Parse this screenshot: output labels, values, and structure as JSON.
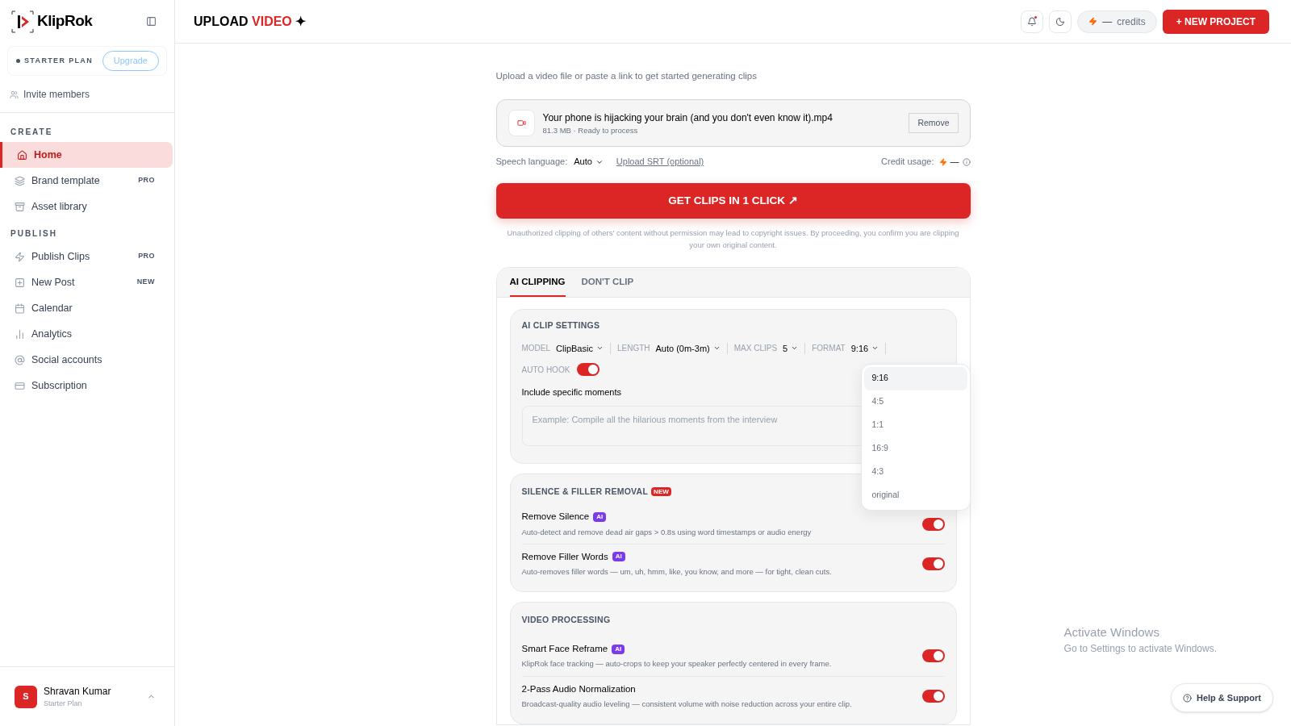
{
  "sidebar": {
    "brand": "KlipRok",
    "plan": {
      "label": "STARTER PLAN",
      "button": "Upgrade"
    },
    "invite": "Invite members",
    "sections": [
      {
        "title": "CREATE",
        "items": [
          {
            "label": "Home",
            "selected": true
          },
          {
            "label": "Brand template",
            "badge": "PRO",
            "selected": false
          },
          {
            "label": "Asset library",
            "selected": false
          }
        ]
      },
      {
        "title": "PUBLISH",
        "items": [
          {
            "label": "Publish Clips",
            "badge": "PRO",
            "selected": false
          },
          {
            "label": "New Post",
            "badge": "NEW",
            "selected": false
          },
          {
            "label": "Calendar",
            "selected": false
          },
          {
            "label": "Analytics",
            "selected": false
          },
          {
            "label": "Social accounts",
            "selected": false
          },
          {
            "label": "Subscription",
            "selected": false
          }
        ]
      }
    ],
    "user": {
      "initial": "S",
      "name": "Shravan Kumar",
      "plan": "Starter Plan"
    }
  },
  "header": {
    "title": "UPLOAD",
    "title_accent": "VIDEO",
    "title_mark": "✦",
    "credits_value": "—",
    "credits_label": "credits",
    "new_project": "+ NEW PROJECT",
    "notification_unread": true
  },
  "upload": {
    "intro": "Upload a video file or paste a link to get started generating clips",
    "file": {
      "name": "Your phone is hijacking your brain (and you don't even know it).mp4",
      "meta": "81.3 MB · Ready to process"
    },
    "remove_button": "Remove",
    "speech_label": "Speech language:",
    "speech_value": "Auto",
    "srt_link": "Upload SRT (optional)",
    "credit_label": "Credit usage:",
    "credit_value": "—",
    "cta": "GET CLIPS IN 1 CLICK ↗",
    "disclaimer": "Unauthorized clipping of others' content without permission may lead to copyright issues. By proceeding, you confirm you are clipping your own original content."
  },
  "tabs": [
    {
      "label": "AI CLIPPING",
      "selected": true
    },
    {
      "label": "DON'T CLIP",
      "selected": false
    }
  ],
  "clip_settings": {
    "title": "AI CLIP SETTINGS",
    "params": [
      {
        "label": "MODEL",
        "value": "ClipBasic"
      },
      {
        "label": "LENGTH",
        "value": "Auto (0m-3m)"
      },
      {
        "label": "MAX CLIPS",
        "value": "5"
      },
      {
        "label": "FORMAT",
        "value": "9:16"
      }
    ],
    "auto_hook": {
      "label": "AUTO HOOK",
      "on": true
    },
    "moments_label": "Include specific moments",
    "moments_placeholder": "Example: Compile all the hilarious moments from the interview"
  },
  "format_menu": {
    "options": [
      {
        "label": "9:16",
        "selected": true
      },
      {
        "label": "4:5",
        "selected": false
      },
      {
        "label": "1:1",
        "selected": false
      },
      {
        "label": "16:9",
        "selected": false
      },
      {
        "label": "4:3",
        "selected": false
      },
      {
        "label": "original",
        "selected": false
      }
    ]
  },
  "groups": [
    {
      "title": "SILENCE & FILLER REMOVAL",
      "badge": "NEW",
      "rows": [
        {
          "title": "Remove Silence",
          "badge": "AI",
          "description": "Auto-detect and remove dead air gaps > 0.8s using word timestamps or audio energy",
          "on": true
        },
        {
          "title": "Remove Filler Words",
          "badge": "AI",
          "description": "Auto-removes filler words — um, uh, hmm, like, you know, and more — for tight, clean cuts.",
          "on": true
        }
      ]
    },
    {
      "title": "VIDEO PROCESSING",
      "rows": [
        {
          "title": "Smart Face Reframe",
          "badge": "AI",
          "description": "KlipRok face tracking — auto-crops to keep your speaker perfectly centered in every frame.",
          "on": true
        },
        {
          "title": "2-Pass Audio Normalization",
          "description": "Broadcast-quality audio leveling — consistent volume with noise reduction across your entire clip.",
          "on": true
        }
      ]
    }
  ],
  "help_button": "Help & Support",
  "os_notice": {
    "title": "Activate Windows",
    "subtitle": "Go to Settings to activate Windows."
  }
}
